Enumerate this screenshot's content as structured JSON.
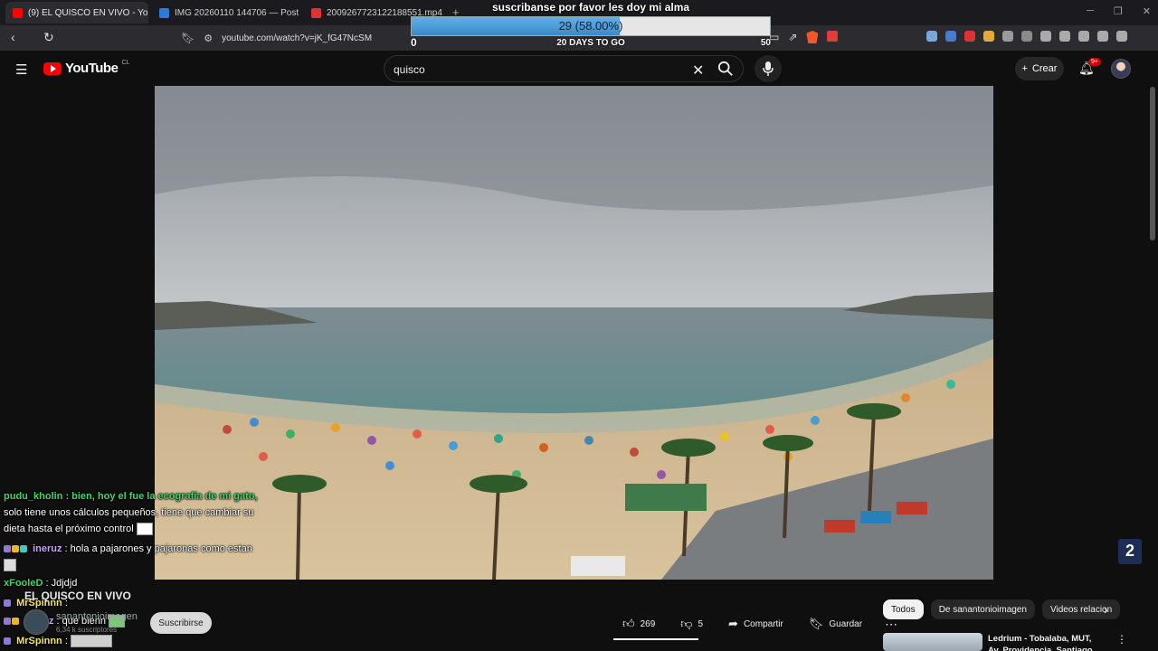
{
  "browser": {
    "tabs": [
      {
        "title": "(9) EL QUISCO EN VIVO - YouTube",
        "active": true,
        "favicon_color": "#ff0000"
      },
      {
        "title": "IMG 20260110 144706 — Postimages",
        "active": false,
        "favicon_color": "#2d7bd6"
      },
      {
        "title": "2009267723122188551.mp4",
        "active": false,
        "favicon_color": "#d33"
      }
    ],
    "new_tab_icon": "plus-icon",
    "url": "youtube.com/watch?v=jK_fG47NcSM"
  },
  "goal_overlay": {
    "title": "suscribanse por favor les doy mi alma",
    "progress_text": "29 (58.00%)",
    "progress_fraction": 0.58,
    "min_label": "0",
    "max_label": "50",
    "days_label": "20 DAYS TO GO"
  },
  "youtube": {
    "logo_text": "YouTube",
    "country_code": "CL",
    "search_value": "quisco",
    "create_label": "Crear",
    "notification_count": "9+",
    "accent_color": "#ff0000"
  },
  "chat": [
    {
      "user": "pudu_kholin",
      "color": "#3fd56a",
      "lines": [
        "pudu_kholin : bien, hoy el fue la ecografía de mi gato,",
        "solo tiene unos cálculos pequeños, tiene que cambiar su",
        "dieta hasta el próximo control"
      ],
      "emote": true
    },
    {
      "user": "ineruz",
      "color": "#c8a3ff",
      "text": " : hola a pajarones y pajaronas como estan",
      "emote": true
    },
    {
      "user": "xFooleD",
      "color": "#3fd56a",
      "text": " : Jdjdjd"
    },
    {
      "user": "MrSpinnn",
      "color": "#f0e36a",
      "text": " : "
    },
    {
      "user": "ineruz",
      "color": "#c8a3ff",
      "text": " : que bienn"
    },
    {
      "user": "MrSpinnn",
      "color": "#f0e36a",
      "text": " : "
    }
  ],
  "video_info": {
    "title": "EL QUISCO EN VIVO",
    "channel": "sanantonioimagen",
    "subscribers": "6,34 k suscriptores",
    "subscribe_label": "Suscribirse",
    "likes": "269",
    "dislikes": "5",
    "share_label": "Compartir",
    "save_label": "Guardar"
  },
  "recommendations": {
    "chips": [
      "Todos",
      "De sanantonioimagen",
      "Videos relacion"
    ],
    "first_title": "Ledrium - Tobalaba, MUT, Av. Providencia, Santiago, Chile"
  },
  "station_logo": "2"
}
